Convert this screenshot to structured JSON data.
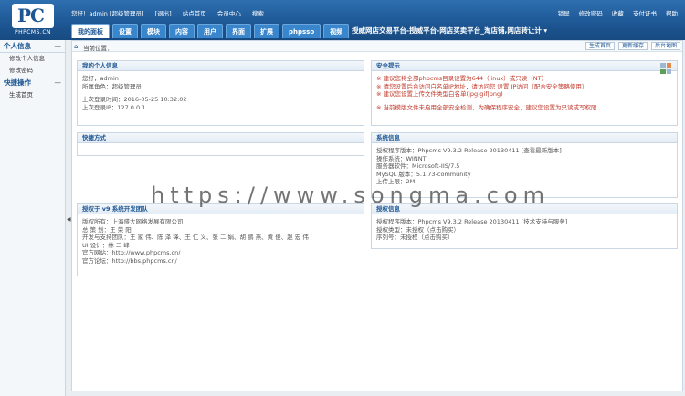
{
  "header": {
    "logo_text": "PHPCMS.CN",
    "logo_mark": "PC",
    "user_line": [
      "您好！admin [超级管理员]",
      "[退出]",
      "站点首页",
      "会员中心",
      "搜索"
    ],
    "right_links": [
      "锁屏",
      "修改密码",
      "收藏",
      "支付证书",
      "帮助"
    ],
    "tabs": [
      "我的面板",
      "设置",
      "模块",
      "内容",
      "用户",
      "界面",
      "扩展",
      "phpsso",
      "视频"
    ],
    "marquee": "授威网店交易平台-授威平台-网店买卖平台_淘店铺,网店转让计 ▾"
  },
  "sidebar": {
    "sections": [
      {
        "title": "个人信息",
        "items": [
          "修改个人信息",
          "修改密码"
        ]
      },
      {
        "title": "快捷操作",
        "items": [
          "生成首页"
        ]
      }
    ],
    "toggle": "—"
  },
  "breadcrumb": {
    "label": "当前位置：",
    "buttons": [
      "生成首页",
      "更新缓存",
      "后台地图"
    ]
  },
  "panels": {
    "personal": {
      "title": "我的个人信息",
      "lines": [
        "您好，admin",
        "所属角色：超级管理员",
        "",
        "上次登录时间：2016-05-25 10:32:02",
        "上次登录IP：127.0.0.1"
      ]
    },
    "security": {
      "title": "安全提示",
      "lines": [
        "※ 建议您将全部phpcms目录设置为644（linux）或只读（NT）",
        "※ 请您设置后台访问白名单IP地址，请访问您 设置 IP访问（配合安全策略使用）",
        "※ 建议您设置上传文件类型白名单(jpg|gif|png)",
        "",
        "※ 当前模版文件未启用全部安全检测，为确保程序安全，建议您设置为只读或写权限"
      ]
    },
    "shortcuts": {
      "title": "快捷方式"
    },
    "system": {
      "title": "系统信息",
      "lines": [
        "授权程序版本：Phpcms V9.3.2 Release 20130411 [查看最新版本]",
        "操作系统：WINNT",
        "服务器软件：Microsoft-IIS/7.5",
        "MySQL 版本：5.1.73-community",
        "上传上限：2M"
      ]
    },
    "team": {
      "title": "授权于 v9 系统开发团队",
      "lines": [
        "版权所有：上海盛大网络发展有限公司",
        "总 策 划：王 荣 阳",
        "开发与支持团队：王 家 伟、陈 泽 锋、王 仁 义、张 二 娟、胡 鹏 燕、黄 俊、赵 宏 伟",
        "UI 设计：林 二 峰",
        "官方网站：http://www.phpcms.cn/",
        "官方论坛：http://bbs.phpcms.cn/"
      ]
    },
    "license": {
      "title": "授权信息",
      "lines": [
        "授权程序版本：Phpcms V9.3.2 Release 20130411 [技术支持与服务]",
        "授权类型：未授权（点击购买）",
        "序列号：未授权（点击购买）"
      ]
    }
  },
  "watermark": "https://www.songma.com"
}
